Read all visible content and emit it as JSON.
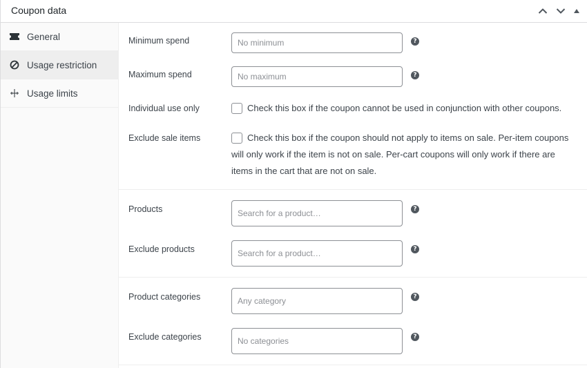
{
  "header": {
    "title": "Coupon data",
    "actions": [
      "chevron-up-icon",
      "chevron-down-icon",
      "triangle-up-icon"
    ]
  },
  "tabs": [
    {
      "label": "General",
      "icon": "ticket-icon",
      "active": false
    },
    {
      "label": "Usage restriction",
      "icon": "block-icon",
      "active": true
    },
    {
      "label": "Usage limits",
      "icon": "limits-icon",
      "active": false
    }
  ],
  "fields": {
    "minimum_spend": {
      "label": "Minimum spend",
      "placeholder": "No minimum",
      "value": ""
    },
    "maximum_spend": {
      "label": "Maximum spend",
      "placeholder": "No maximum",
      "value": ""
    },
    "individual_use": {
      "label": "Individual use only",
      "checked": false,
      "description": "Check this box if the coupon cannot be used in conjunction with other coupons."
    },
    "exclude_sale_items": {
      "label": "Exclude sale items",
      "checked": false,
      "description_lines": [
        "Check this box if the coupon should not apply to items on sale. Per-item coupons",
        "will only work if the item is not on sale. Per-cart coupons will only work if there are",
        "items in the cart that are not on sale."
      ]
    },
    "products": {
      "label": "Products",
      "placeholder": "Search for a product…"
    },
    "exclude_products": {
      "label": "Exclude products",
      "placeholder": "Search for a product…"
    },
    "product_categories": {
      "label": "Product categories",
      "placeholder": "Any category"
    },
    "exclude_categories": {
      "label": "Exclude categories",
      "placeholder": "No categories"
    }
  },
  "help_icon": "?",
  "colors": {
    "help_bg": "#50575e",
    "active_tab_bg": "#eeeeee",
    "border": "#8c8f94"
  }
}
